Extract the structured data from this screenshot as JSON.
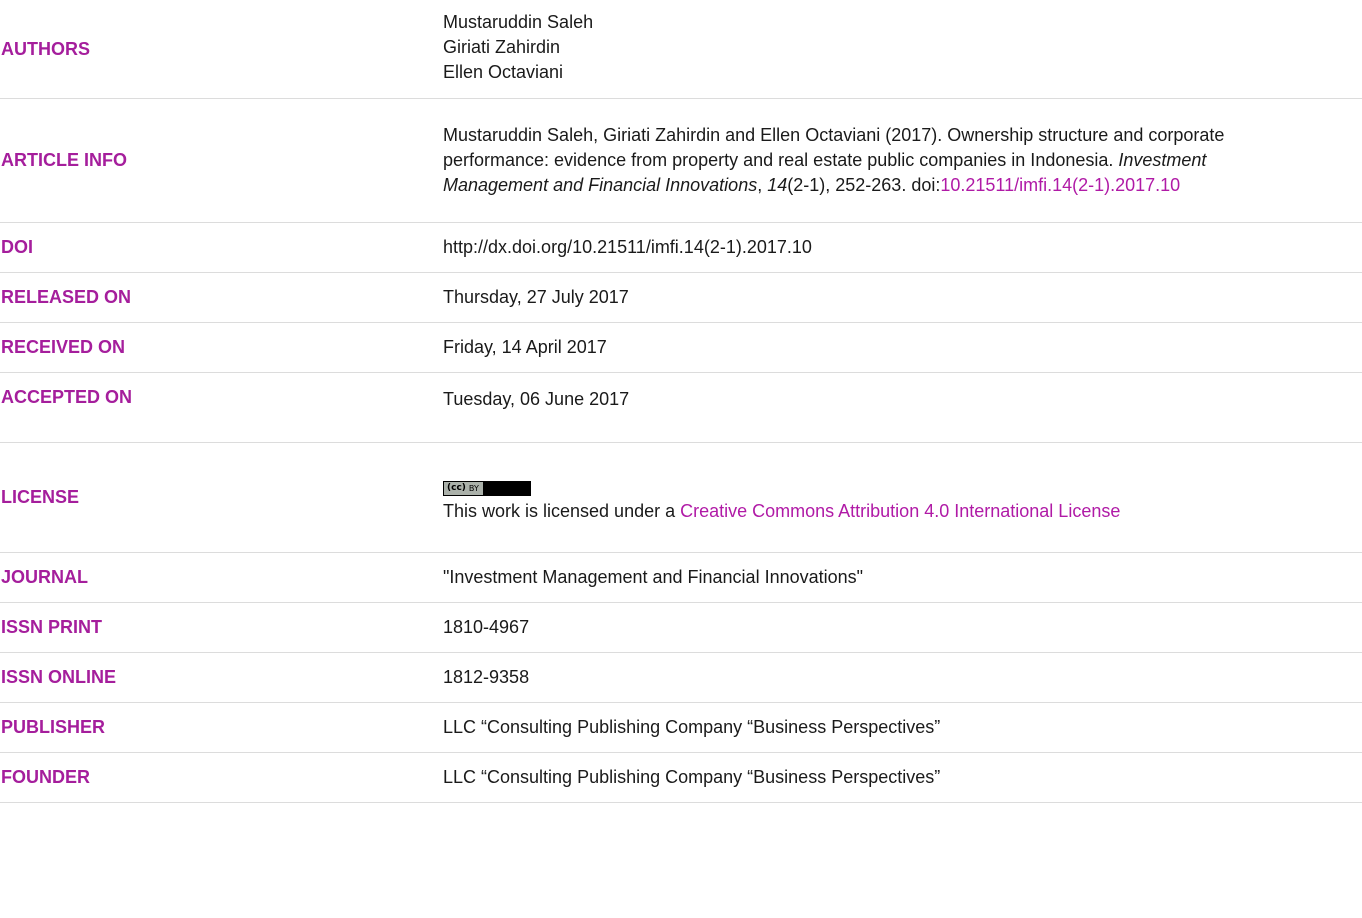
{
  "authors": {
    "label": "AUTHORS",
    "names": [
      "Mustaruddin Saleh",
      "Giriati Zahirdin",
      "Ellen Octaviani"
    ]
  },
  "article_info": {
    "label": "ARTICLE INFO",
    "text_1": "Mustaruddin Saleh, Giriati Zahirdin and Ellen Octaviani (2017). Ownership structure and corporate performance: evidence from property and real estate public companies in Indonesia. ",
    "journal_italic": "Investment Management and Financial Innovations",
    "sep_1": ", ",
    "volume_italic": "14",
    "text_2": "(2-1), 252-263. doi:",
    "doi_link": "10.21511/imfi.14(2-1).2017.10"
  },
  "doi": {
    "label": "DOI",
    "value": "http://dx.doi.org/10.21511/imfi.14(2-1).2017.10"
  },
  "released_on": {
    "label": "RELEASED ON",
    "value": "Thursday, 27 July 2017"
  },
  "received_on": {
    "label": "RECEIVED ON",
    "value": "Friday, 14 April 2017"
  },
  "accepted_on": {
    "label": "ACCEPTED ON",
    "value": "Tuesday, 06 June 2017"
  },
  "license": {
    "label": "LICENSE",
    "badge_cc": "(cc)",
    "badge_by": "BY",
    "text_prefix": "This work is licensed under a ",
    "link_text": "Creative Commons Attribution 4.0 International License"
  },
  "journal": {
    "label": "JOURNAL",
    "value": "\"Investment Management and Financial Innovations\""
  },
  "issn_print": {
    "label": "ISSN PRINT",
    "value": "1810-4967"
  },
  "issn_online": {
    "label": "ISSN ONLINE",
    "value": "1812-9358"
  },
  "publisher": {
    "label": "PUBLISHER",
    "value": "LLC “Consulting Publishing Company “Business Perspectives”"
  },
  "founder": {
    "label": "FOUNDER",
    "value": "LLC “Consulting Publishing Company “Business Perspectives”"
  },
  "colors": {
    "label": "#a51e9c",
    "link": "#b01aa6",
    "divider": "#dcdcdc"
  }
}
